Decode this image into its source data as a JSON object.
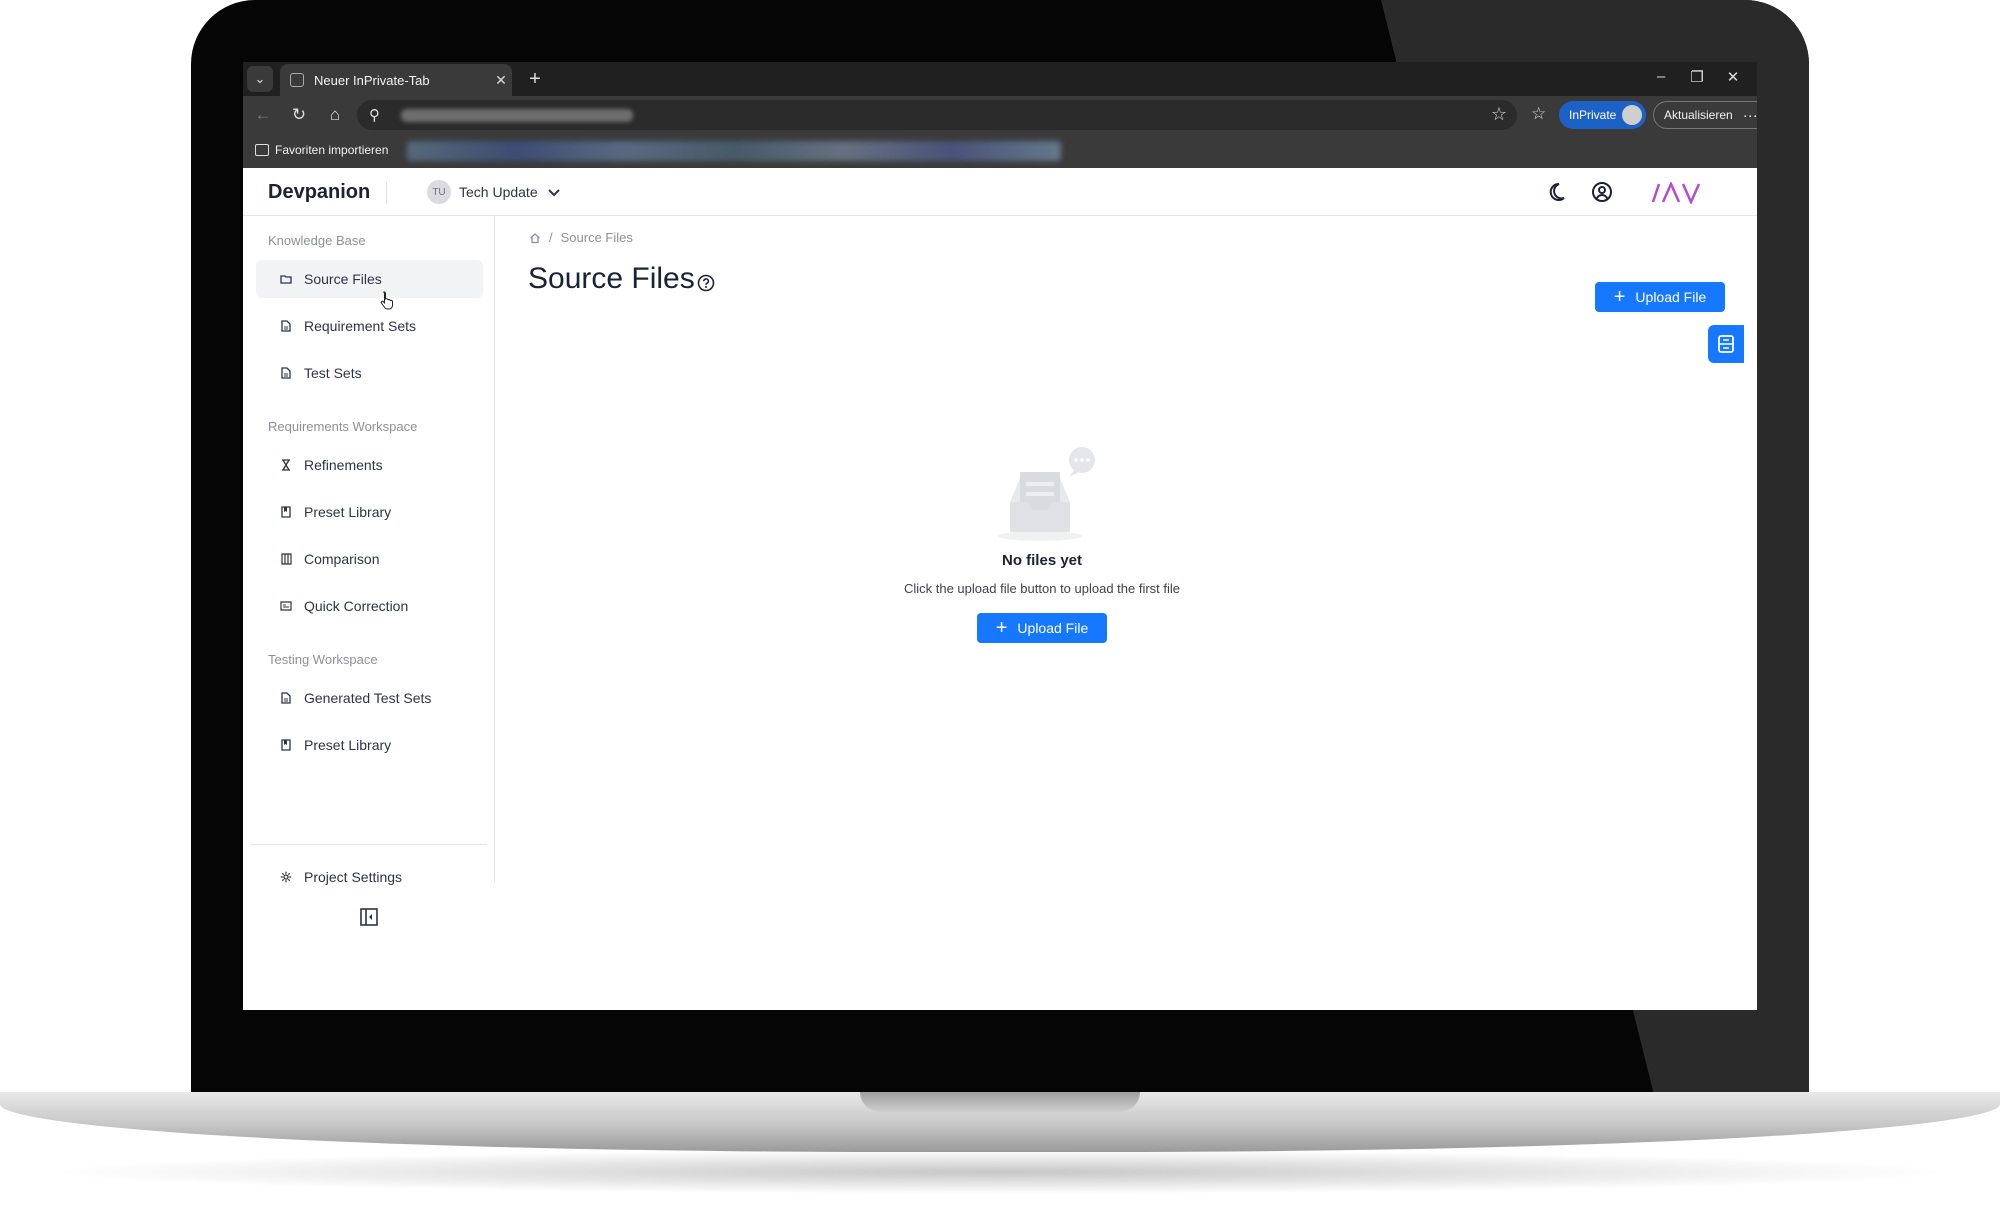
{
  "browser": {
    "tab_title": "Neuer InPrivate-Tab",
    "inprivate_label": "InPrivate",
    "update_label": "Aktualisieren",
    "import_favorites_label": "Favoriten importieren"
  },
  "app": {
    "brand": "Devpanion",
    "project": {
      "initials": "TU",
      "name": "Tech Update"
    },
    "logo_text": "IAV",
    "colors": {
      "primary": "#1677ff",
      "logo": "#b44bd1",
      "sidebar_active_bg": "#f2f3f5"
    }
  },
  "sidebar": {
    "sections": [
      {
        "title": "Knowledge Base",
        "items": [
          {
            "label": "Source Files",
            "icon": "folder-icon",
            "active": true
          },
          {
            "label": "Requirement Sets",
            "icon": "document-icon"
          },
          {
            "label": "Test Sets",
            "icon": "document-icon"
          }
        ]
      },
      {
        "title": "Requirements Workspace",
        "items": [
          {
            "label": "Refinements",
            "icon": "hourglass-icon"
          },
          {
            "label": "Preset Library",
            "icon": "book-icon"
          },
          {
            "label": "Comparison",
            "icon": "columns-icon"
          },
          {
            "label": "Quick Correction",
            "icon": "card-icon"
          }
        ]
      },
      {
        "title": "Testing Workspace",
        "items": [
          {
            "label": "Generated Test Sets",
            "icon": "document-icon"
          },
          {
            "label": "Preset Library",
            "icon": "book-icon"
          }
        ]
      }
    ],
    "footer": {
      "label": "Project Settings",
      "icon": "gear-icon"
    }
  },
  "main": {
    "breadcrumb": [
      "Source Files"
    ],
    "title": "Source Files",
    "upload_label": "Upload File",
    "empty": {
      "title": "No files yet",
      "description": "Click the upload file button to upload the first file",
      "button_label": "Upload File"
    }
  }
}
